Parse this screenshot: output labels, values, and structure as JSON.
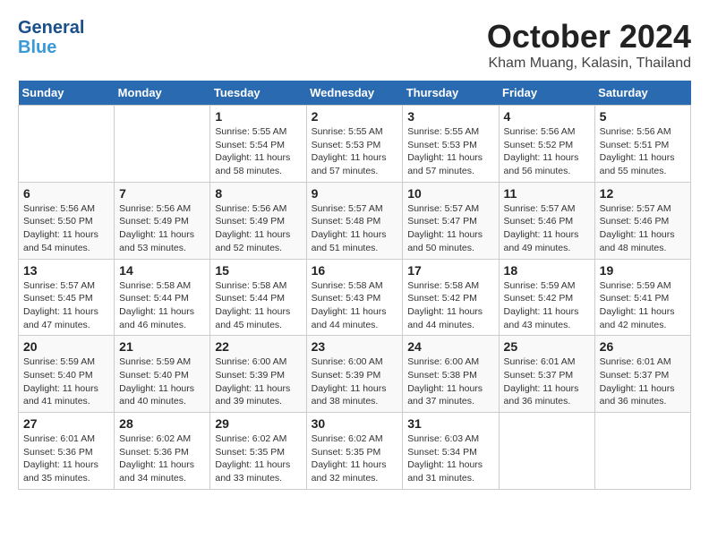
{
  "header": {
    "logo_line1": "General",
    "logo_line2": "Blue",
    "month": "October 2024",
    "location": "Kham Muang, Kalasin, Thailand"
  },
  "weekdays": [
    "Sunday",
    "Monday",
    "Tuesday",
    "Wednesday",
    "Thursday",
    "Friday",
    "Saturday"
  ],
  "weeks": [
    [
      {
        "day": "",
        "info": ""
      },
      {
        "day": "",
        "info": ""
      },
      {
        "day": "1",
        "info": "Sunrise: 5:55 AM\nSunset: 5:54 PM\nDaylight: 11 hours and 58 minutes."
      },
      {
        "day": "2",
        "info": "Sunrise: 5:55 AM\nSunset: 5:53 PM\nDaylight: 11 hours and 57 minutes."
      },
      {
        "day": "3",
        "info": "Sunrise: 5:55 AM\nSunset: 5:53 PM\nDaylight: 11 hours and 57 minutes."
      },
      {
        "day": "4",
        "info": "Sunrise: 5:56 AM\nSunset: 5:52 PM\nDaylight: 11 hours and 56 minutes."
      },
      {
        "day": "5",
        "info": "Sunrise: 5:56 AM\nSunset: 5:51 PM\nDaylight: 11 hours and 55 minutes."
      }
    ],
    [
      {
        "day": "6",
        "info": "Sunrise: 5:56 AM\nSunset: 5:50 PM\nDaylight: 11 hours and 54 minutes."
      },
      {
        "day": "7",
        "info": "Sunrise: 5:56 AM\nSunset: 5:49 PM\nDaylight: 11 hours and 53 minutes."
      },
      {
        "day": "8",
        "info": "Sunrise: 5:56 AM\nSunset: 5:49 PM\nDaylight: 11 hours and 52 minutes."
      },
      {
        "day": "9",
        "info": "Sunrise: 5:57 AM\nSunset: 5:48 PM\nDaylight: 11 hours and 51 minutes."
      },
      {
        "day": "10",
        "info": "Sunrise: 5:57 AM\nSunset: 5:47 PM\nDaylight: 11 hours and 50 minutes."
      },
      {
        "day": "11",
        "info": "Sunrise: 5:57 AM\nSunset: 5:46 PM\nDaylight: 11 hours and 49 minutes."
      },
      {
        "day": "12",
        "info": "Sunrise: 5:57 AM\nSunset: 5:46 PM\nDaylight: 11 hours and 48 minutes."
      }
    ],
    [
      {
        "day": "13",
        "info": "Sunrise: 5:57 AM\nSunset: 5:45 PM\nDaylight: 11 hours and 47 minutes."
      },
      {
        "day": "14",
        "info": "Sunrise: 5:58 AM\nSunset: 5:44 PM\nDaylight: 11 hours and 46 minutes."
      },
      {
        "day": "15",
        "info": "Sunrise: 5:58 AM\nSunset: 5:44 PM\nDaylight: 11 hours and 45 minutes."
      },
      {
        "day": "16",
        "info": "Sunrise: 5:58 AM\nSunset: 5:43 PM\nDaylight: 11 hours and 44 minutes."
      },
      {
        "day": "17",
        "info": "Sunrise: 5:58 AM\nSunset: 5:42 PM\nDaylight: 11 hours and 44 minutes."
      },
      {
        "day": "18",
        "info": "Sunrise: 5:59 AM\nSunset: 5:42 PM\nDaylight: 11 hours and 43 minutes."
      },
      {
        "day": "19",
        "info": "Sunrise: 5:59 AM\nSunset: 5:41 PM\nDaylight: 11 hours and 42 minutes."
      }
    ],
    [
      {
        "day": "20",
        "info": "Sunrise: 5:59 AM\nSunset: 5:40 PM\nDaylight: 11 hours and 41 minutes."
      },
      {
        "day": "21",
        "info": "Sunrise: 5:59 AM\nSunset: 5:40 PM\nDaylight: 11 hours and 40 minutes."
      },
      {
        "day": "22",
        "info": "Sunrise: 6:00 AM\nSunset: 5:39 PM\nDaylight: 11 hours and 39 minutes."
      },
      {
        "day": "23",
        "info": "Sunrise: 6:00 AM\nSunset: 5:39 PM\nDaylight: 11 hours and 38 minutes."
      },
      {
        "day": "24",
        "info": "Sunrise: 6:00 AM\nSunset: 5:38 PM\nDaylight: 11 hours and 37 minutes."
      },
      {
        "day": "25",
        "info": "Sunrise: 6:01 AM\nSunset: 5:37 PM\nDaylight: 11 hours and 36 minutes."
      },
      {
        "day": "26",
        "info": "Sunrise: 6:01 AM\nSunset: 5:37 PM\nDaylight: 11 hours and 36 minutes."
      }
    ],
    [
      {
        "day": "27",
        "info": "Sunrise: 6:01 AM\nSunset: 5:36 PM\nDaylight: 11 hours and 35 minutes."
      },
      {
        "day": "28",
        "info": "Sunrise: 6:02 AM\nSunset: 5:36 PM\nDaylight: 11 hours and 34 minutes."
      },
      {
        "day": "29",
        "info": "Sunrise: 6:02 AM\nSunset: 5:35 PM\nDaylight: 11 hours and 33 minutes."
      },
      {
        "day": "30",
        "info": "Sunrise: 6:02 AM\nSunset: 5:35 PM\nDaylight: 11 hours and 32 minutes."
      },
      {
        "day": "31",
        "info": "Sunrise: 6:03 AM\nSunset: 5:34 PM\nDaylight: 11 hours and 31 minutes."
      },
      {
        "day": "",
        "info": ""
      },
      {
        "day": "",
        "info": ""
      }
    ]
  ]
}
